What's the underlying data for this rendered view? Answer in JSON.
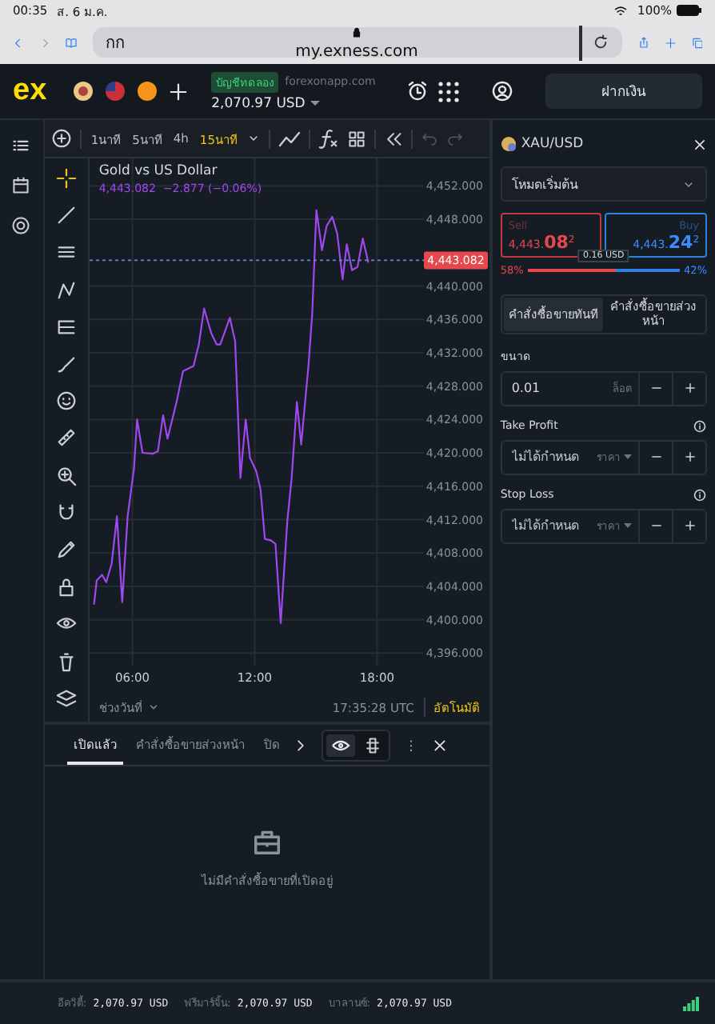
{
  "status_bar": {
    "time": "00:35",
    "date": "ส. 6 ม.ค.",
    "battery": "100%"
  },
  "browser": {
    "text_size_button": "กก",
    "url": "my.exness.com"
  },
  "header": {
    "logo": "ex",
    "account_type": "บัญชีทดลอง",
    "server": "forexonapp.com",
    "balance": "2,070.97 USD",
    "deposit_button": "ฝากเงิน"
  },
  "chart_toolbar": {
    "timeframes": [
      {
        "label": "1นาที",
        "selected": false
      },
      {
        "label": "5นาที",
        "selected": false
      },
      {
        "label": "4h",
        "selected": false
      },
      {
        "label": "15นาที",
        "selected": true
      }
    ]
  },
  "chart": {
    "quote": "4,443.082  −2.877 (−0.06%)",
    "range_button": "ช่วงวันที่",
    "clock": "17:35:28 UTC",
    "auto_button": "อัตโนมัติ",
    "chart_data": {
      "type": "line",
      "xlim": [
        3.9,
        20.3
      ],
      "ylim": [
        4394.5,
        4455.3
      ],
      "xticks": [
        {
          "value": 6,
          "label": "06:00"
        },
        {
          "value": 12,
          "label": "12:00"
        },
        {
          "value": 18,
          "label": "18:00"
        }
      ],
      "yticks": [
        {
          "value": 4396,
          "label": "4,396.000"
        },
        {
          "value": 4400,
          "label": "4,400.000"
        },
        {
          "value": 4404,
          "label": "4,404.000"
        },
        {
          "value": 4408,
          "label": "4,408.000"
        },
        {
          "value": 4412,
          "label": "4,412.000"
        },
        {
          "value": 4416,
          "label": "4,416.000"
        },
        {
          "value": 4420,
          "label": "4,420.000"
        },
        {
          "value": 4424,
          "label": "4,424.000"
        },
        {
          "value": 4428,
          "label": "4,428.000"
        },
        {
          "value": 4432,
          "label": "4,432.000"
        },
        {
          "value": 4436,
          "label": "4,436.000"
        },
        {
          "value": 4440,
          "label": "4,440.000"
        },
        {
          "value": 4448,
          "label": "4,448.000"
        },
        {
          "value": 4452,
          "label": "4,452.000"
        }
      ],
      "x": [
        4.12,
        4.25,
        4.51,
        4.72,
        4.98,
        5.24,
        5.5,
        5.77,
        6.08,
        6.23,
        6.5,
        7.0,
        7.25,
        7.51,
        7.72,
        8.17,
        8.48,
        9.0,
        9.26,
        9.52,
        9.86,
        10.13,
        10.31,
        10.78,
        11.04,
        11.3,
        11.56,
        11.77,
        12.08,
        12.29,
        12.5,
        12.81,
        13.02,
        13.28,
        13.6,
        13.81,
        14.07,
        14.28,
        14.64,
        14.82,
        15.03,
        15.3,
        15.53,
        15.8,
        16.05,
        16.31,
        16.52,
        16.78,
        17.04,
        17.3,
        17.57
      ],
      "series": [
        {
          "name": "Gold vs US Dollar",
          "color": "#a048f0",
          "values": [
            4401.9,
            4404.7,
            4405.4,
            4404.5,
            4406.7,
            4412.4,
            4402.1,
            4412.4,
            4418.2,
            4424,
            4420,
            4419.9,
            4420.2,
            4424.5,
            4421.7,
            4426.1,
            4429.8,
            4430.4,
            4433,
            4437.3,
            4434.4,
            4433,
            4433,
            4436.2,
            4433.4,
            4417,
            4424,
            4419.4,
            4417.8,
            4415.6,
            4409.7,
            4409.5,
            4409.1,
            4399.6,
            4411.8,
            4416.9,
            4426.1,
            4421,
            4430.6,
            4436.7,
            4449.1,
            4444.3,
            4447.2,
            4448.3,
            4446.3,
            4440.8,
            4445,
            4441.9,
            4442.3,
            4445.7,
            4442.9
          ]
        }
      ],
      "grid": true,
      "ref_lines": [
        {
          "value": 4443.082,
          "label": "4,443.082",
          "axis": "y"
        }
      ]
    }
  },
  "positions": {
    "tabs": [
      {
        "label": "เปิดแล้ว",
        "selected": true
      },
      {
        "label": "คำสั่งซื้อขายส่วงหน้า",
        "selected": false
      },
      {
        "label": "ปิด",
        "selected": false
      }
    ],
    "empty_message": "ไม่มีคำสั่งซื้อขายที่เปิดอยู่"
  },
  "order_panel": {
    "symbol": "XAU/USD",
    "mode": "โหมดเริ่มต้น",
    "sell": {
      "label": "Sell",
      "price": "4,443.**08**$^{2}$"
    },
    "buy": {
      "label": "Buy",
      "price": "4,443.**24**$^{2}$"
    },
    "spread": "0.16 USD",
    "sell_share": "58%",
    "buy_share": "42%",
    "sentiment": {
      "level": 0.58
    },
    "order_types": [
      {
        "label": "คำสั่งซื้อขายทันที",
        "selected": true
      },
      {
        "label": "คำสั่งซื้อขายส่วงหน้า",
        "selected": false
      }
    ],
    "volume_label": "ขนาด",
    "volume": "0.01",
    "volume_unit": "ล็อต",
    "take_profit": {
      "label": "Take Profit",
      "placeholder": "ไม่ได้กำหนด",
      "unit": "ราคา"
    },
    "stop_loss": {
      "label": "Stop Loss",
      "placeholder": "ไม่ได้กำหนด",
      "unit": "ราคา"
    }
  },
  "footer": {
    "items": [
      {
        "label": "อีควิตี้:",
        "value": "2,070.97 USD"
      },
      {
        "label": "ฟรีมาร์จิ้น:",
        "value": "2,070.97 USD"
      },
      {
        "label": "บาลานซ์:",
        "value": "2,070.97 USD"
      }
    ]
  }
}
